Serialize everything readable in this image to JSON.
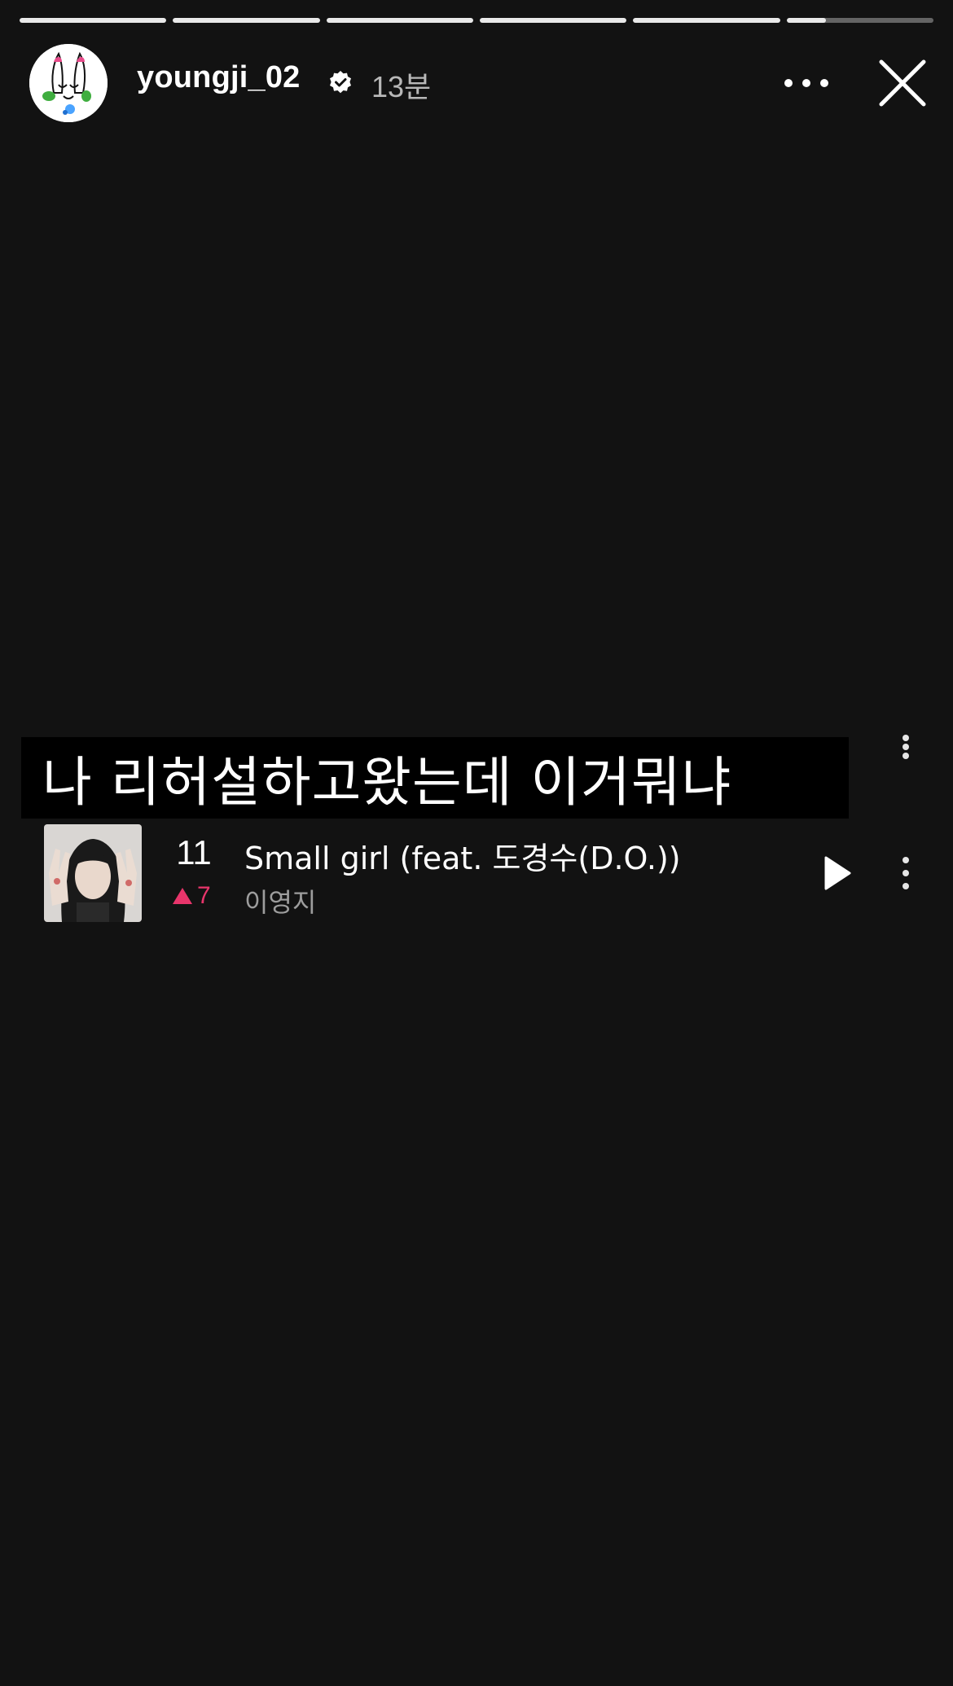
{
  "story": {
    "progress_segments": [
      1,
      1,
      1,
      1,
      1,
      0.27
    ],
    "user": {
      "username": "youngji_02",
      "verified": true,
      "time_ago": "13분"
    },
    "caption": {
      "text": "나 리허설하고왔는데 이거뭐냐"
    },
    "song": {
      "rank": "11",
      "rank_change": "7",
      "rank_change_direction": "up",
      "title": "Small girl (feat. 도경수(D.O.))",
      "artist": "이영지"
    },
    "icons": {
      "more": "more-horizontal-icon",
      "close": "close-icon",
      "verified": "verified-badge-icon",
      "play": "play-icon",
      "kebab": "more-vertical-icon"
    },
    "colors": {
      "background": "#121212",
      "accent_up": "#e8356b",
      "secondary_text": "#9d9d9d"
    }
  }
}
